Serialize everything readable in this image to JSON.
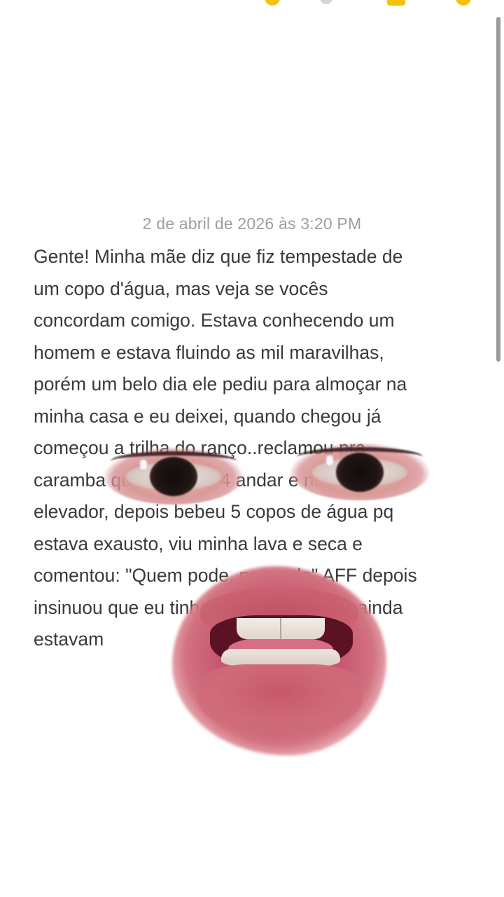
{
  "toolbar": {
    "icons": [
      "yellow-circle-icon",
      "gray-circle-icon",
      "yellow-square-icon",
      "yellow-circle-icon"
    ]
  },
  "note": {
    "timestamp": "2 de abril de 2026 às 3:20 PM",
    "body": "Gente! Minha mãe diz que fiz tempestade de\num copo d'água, mas veja se vocês\nconcordam comigo. Estava conhecendo um\nhomem e estava fluindo as mil maravilhas,\nporém um belo dia ele pediu para almoçar na\nminha casa e eu deixei, quando chegou já\ncomeçou a trilha do ranço..reclamou pra\ncaramba que moro no 4 andar e não tem\nelevador, depois bebeu 5 copos de água pq\nestava exausto, viu minha lava e seca e\ncomentou: \"Quem pode, poooode\" AFF depois\ninsinuou que eu tinha que lavar as que ainda\nestavam"
  },
  "stickers": [
    "eye-sticker",
    "eye-sticker",
    "mouth-sticker"
  ],
  "colors": {
    "background": "#ffffff",
    "text": "#3a3a3a",
    "timestamp": "#9e9e9e",
    "accent": "#f2c20f"
  }
}
